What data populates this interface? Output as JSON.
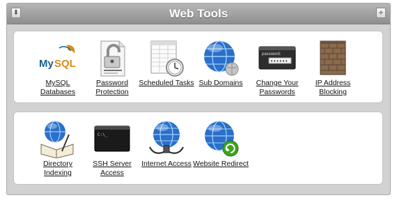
{
  "header": {
    "title": "Web Tools",
    "left_button_glyph": "⬍",
    "right_button_glyph": "+"
  },
  "row1": [
    {
      "id": "mysql",
      "label": "MySQL Databases",
      "line1": "MySQL",
      "line2": "Databases",
      "icon": "mysql-logo-icon"
    },
    {
      "id": "password-protection",
      "label": "Password Protection",
      "line1": "Password",
      "line2": "Protection",
      "icon": "padlock-document-icon"
    },
    {
      "id": "scheduled-tasks",
      "label": "Scheduled Tasks",
      "line1": "Scheduled Tasks",
      "line2": "",
      "icon": "calendar-clock-icon"
    },
    {
      "id": "sub-domains",
      "label": "Sub Domains",
      "line1": "Sub Domains",
      "line2": "",
      "icon": "globe-icon"
    },
    {
      "id": "change-passwords",
      "label": "Change Your Passwords",
      "line1": "Change Your",
      "line2": "Passwords",
      "icon": "password-box-icon",
      "password_caption": "password:"
    },
    {
      "id": "ip-blocking",
      "label": "IP Address Blocking",
      "line1": "IP Address",
      "line2": "Blocking",
      "icon": "brick-wall-icon"
    }
  ],
  "row2": [
    {
      "id": "directory-indexing",
      "label": "Directory Indexing",
      "line1": "Directory",
      "line2": "Indexing",
      "icon": "globe-book-icon"
    },
    {
      "id": "ssh-access",
      "label": "SSH Server Access",
      "line1": "SSH Server",
      "line2": "Access",
      "icon": "terminal-icon",
      "prompt": "C:\\_"
    },
    {
      "id": "internet-access",
      "label": "Internet Access",
      "line1": "Internet Access",
      "line2": "",
      "icon": "globe-cable-icon"
    },
    {
      "id": "website-redirect",
      "label": "Website Redirect",
      "line1": "Website Redirect",
      "line2": "",
      "icon": "globe-redirect-icon"
    }
  ],
  "colors": {
    "globe": "#2a6fc9",
    "header": "#9d9d9d",
    "panel": "#d2d2d2",
    "redirect_arrow": "#3fa31e"
  }
}
